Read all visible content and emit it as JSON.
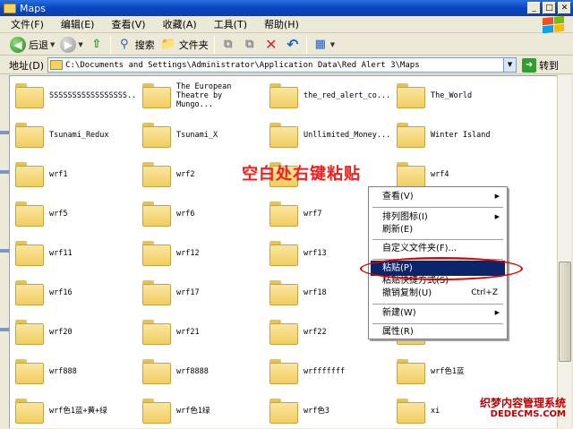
{
  "window": {
    "title": "Maps",
    "buttons": {
      "minimize": "_",
      "maximize": "□",
      "close": "✕"
    }
  },
  "menubar": [
    "文件(F)",
    "编辑(E)",
    "查看(V)",
    "收藏(A)",
    "工具(T)",
    "帮助(H)"
  ],
  "toolbar": {
    "back_label": "后退",
    "search_label": "搜索",
    "folders_label": "文件夹"
  },
  "addressbar": {
    "label": "地址(D)",
    "path": "C:\\Documents and Settings\\Administrator\\Application Data\\Red Alert 3\\Maps",
    "go_label": "转到"
  },
  "files": [
    "SSSSSSSSSSSSSSSSS...",
    "The European Theatre by Mungo...",
    "the_red_alert_co...",
    "The_World",
    "Tsunami_Redux",
    "Tsunami_X",
    "Unllimited_Money...",
    "Winter Island",
    "wrf1",
    "wrf2",
    "",
    "wrf4",
    "wrf5",
    "wrf6",
    "wrf7",
    "",
    "wrf11",
    "wrf12",
    "wrf13",
    "",
    "wrf16",
    "wrf17",
    "wrf18",
    "",
    "wrf20",
    "wrf21",
    "wrf22",
    "",
    "wrf888",
    "wrf8888",
    "wrfffffff",
    "wrf色1蓝",
    "wrf色1蓝+黄+绿",
    "wrf色1绿",
    "wrf色3",
    "xi"
  ],
  "instruction_text": "空白处右键粘贴",
  "context_menu": {
    "items": [
      {
        "label": "查看(V)",
        "submenu": true
      },
      {
        "label": "排列图标(I)",
        "submenu": true
      },
      {
        "label": "刷新(E)"
      },
      {
        "label": "自定义文件夹(F)..."
      },
      {
        "label": "粘贴(P)",
        "selected": true
      },
      {
        "label": "粘贴快捷方式(S)"
      },
      {
        "label": "撤销复制(U)",
        "shortcut": "Ctrl+Z"
      },
      {
        "label": "新建(W)",
        "submenu": true
      },
      {
        "label": "属性(R)"
      }
    ],
    "submenu_arrow": "▶"
  },
  "watermark": {
    "line1": "织梦内容管理系统",
    "line2": "DEDECMS.COM"
  },
  "colors": {
    "titlebar": "#0a46c2",
    "selection": "#0b246a",
    "annotation": "#e00000"
  }
}
